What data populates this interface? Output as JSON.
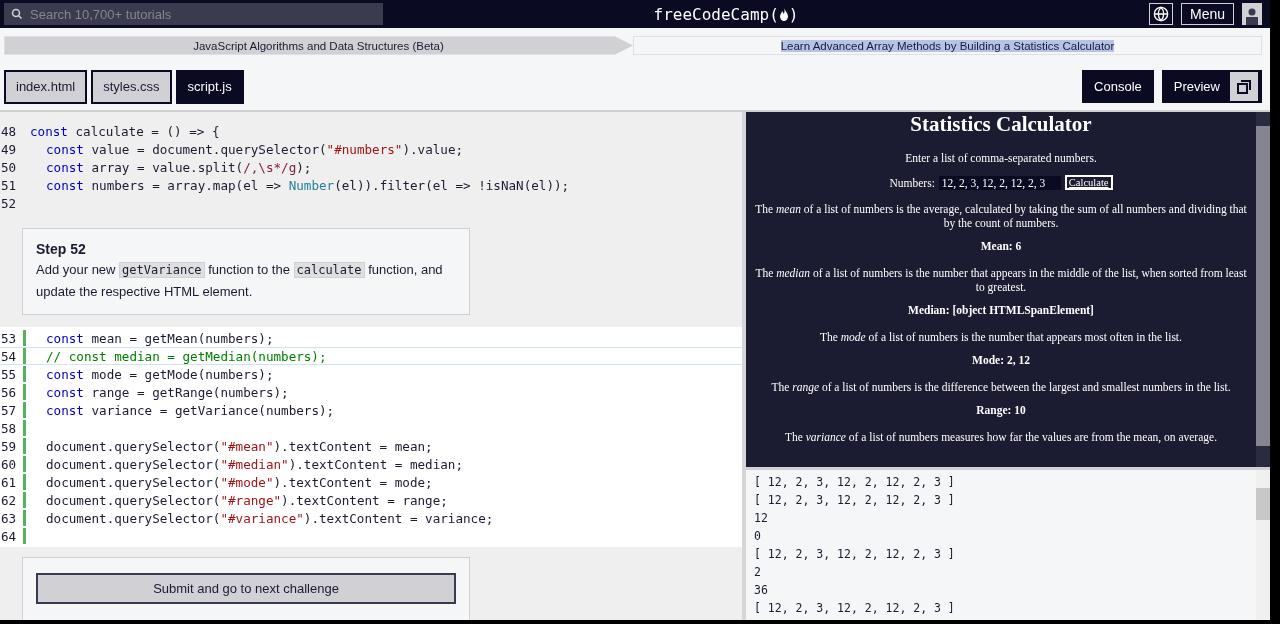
{
  "navbar": {
    "search": {
      "placeholder": "Search 10,700+ tutorials"
    },
    "logo": {
      "text": "freeCodeCamp",
      "open": "(",
      "close": ")"
    },
    "menu_button": "Menu"
  },
  "breadcrumb": [
    {
      "label": "JavaScript Algorithms and Data Structures (Beta)",
      "highlighted": false
    },
    {
      "label": "Learn Advanced Array Methods by Building a Statistics Calculator",
      "highlighted": true
    }
  ],
  "file_tabs": [
    {
      "label": "index.html",
      "selected": false
    },
    {
      "label": "styles.css",
      "selected": false
    },
    {
      "label": "script.js",
      "selected": true
    }
  ],
  "panel_buttons": [
    "Console",
    "Preview"
  ],
  "editor": {
    "code_top": [
      {
        "number": "48",
        "tokens": [
          {
            "kind": "keyword",
            "text": "const"
          },
          {
            "kind": "plain",
            "text": " calculate = () => {"
          }
        ]
      },
      {
        "number": "49",
        "indented": true,
        "tokens": [
          {
            "kind": "keyword",
            "text": "const"
          },
          {
            "kind": "plain",
            "text": " value = document.querySelector("
          },
          {
            "kind": "string",
            "text": "\"#numbers\""
          },
          {
            "kind": "plain",
            "text": ").value;"
          }
        ]
      },
      {
        "number": "50",
        "indented": true,
        "tokens": [
          {
            "kind": "keyword",
            "text": "const"
          },
          {
            "kind": "plain",
            "text": " array = value.split("
          },
          {
            "kind": "regex",
            "text": "/,\\s*/g"
          },
          {
            "kind": "plain",
            "text": ");"
          }
        ]
      },
      {
        "number": "51",
        "indented": true,
        "tokens": [
          {
            "kind": "keyword",
            "text": "const"
          },
          {
            "kind": "plain",
            "text": " numbers = array.map(el => "
          },
          {
            "kind": "builtin",
            "text": "Number"
          },
          {
            "kind": "plain",
            "text": "(el)).filter(el => !isNaN(el));"
          }
        ]
      },
      {
        "number": "52"
      }
    ],
    "step": {
      "title": "Step 52",
      "parts": [
        {
          "kind": "text",
          "text": "Add your new "
        },
        {
          "kind": "code",
          "text": "getVariance"
        },
        {
          "kind": "text",
          "text": " function to the "
        },
        {
          "kind": "code",
          "text": "calculate"
        },
        {
          "kind": "text",
          "text": " function, and update the respective HTML element."
        }
      ]
    },
    "code_bottom": [
      {
        "number": "53",
        "active": false,
        "indented": true,
        "tokens": [
          {
            "kind": "keyword",
            "text": "const"
          },
          {
            "kind": "plain",
            "text": " mean = getMean(numbers);"
          }
        ]
      },
      {
        "number": "54",
        "active": true,
        "indented": true,
        "tokens": [
          {
            "kind": "comment",
            "text": "// const median = getMedian(numbers);"
          }
        ]
      },
      {
        "number": "55",
        "active": false,
        "indented": true,
        "tokens": [
          {
            "kind": "keyword",
            "text": "const"
          },
          {
            "kind": "plain",
            "text": " mode = getMode(numbers);"
          }
        ]
      },
      {
        "number": "56",
        "active": false,
        "indented": true,
        "tokens": [
          {
            "kind": "keyword",
            "text": "const"
          },
          {
            "kind": "plain",
            "text": " range = getRange(numbers);"
          }
        ]
      },
      {
        "number": "57",
        "active": false,
        "indented": true,
        "tokens": [
          {
            "kind": "keyword",
            "text": "const"
          },
          {
            "kind": "plain",
            "text": " variance = getVariance(numbers);"
          }
        ]
      },
      {
        "number": "58",
        "active": false
      },
      {
        "number": "59",
        "active": false,
        "indented": true,
        "tokens": [
          {
            "kind": "plain",
            "text": "document.querySelector("
          },
          {
            "kind": "string",
            "text": "\"#mean\""
          },
          {
            "kind": "plain",
            "text": ").textContent = mean;"
          }
        ]
      },
      {
        "number": "60",
        "active": false,
        "indented": true,
        "tokens": [
          {
            "kind": "plain",
            "text": "document.querySelector("
          },
          {
            "kind": "string",
            "text": "\"#median\""
          },
          {
            "kind": "plain",
            "text": ").textContent = median;"
          }
        ]
      },
      {
        "number": "61",
        "active": false,
        "indented": true,
        "tokens": [
          {
            "kind": "plain",
            "text": "document.querySelector("
          },
          {
            "kind": "string",
            "text": "\"#mode\""
          },
          {
            "kind": "plain",
            "text": ").textContent = mode;"
          }
        ]
      },
      {
        "number": "62",
        "active": false,
        "indented": true,
        "tokens": [
          {
            "kind": "plain",
            "text": "document.querySelector("
          },
          {
            "kind": "string",
            "text": "\"#range\""
          },
          {
            "kind": "plain",
            "text": ").textContent = range;"
          }
        ]
      },
      {
        "number": "63",
        "active": false,
        "indented": true,
        "tokens": [
          {
            "kind": "plain",
            "text": "document.querySelector("
          },
          {
            "kind": "string",
            "text": "\"#variance\""
          },
          {
            "kind": "plain",
            "text": ").textContent = variance;"
          }
        ]
      },
      {
        "number": "64",
        "active": false
      }
    ],
    "submit_button": "Submit and go to next challenge"
  },
  "preview": {
    "title": "Statistics Calculator",
    "intro": "Enter a list of comma-separated numbers.",
    "input_label": "Numbers:",
    "input_value": "12, 2, 3, 12, 2, 12, 2, 3",
    "calculate_button": "Calculate",
    "blocks": [
      {
        "kind": "paragraph",
        "text": "The *mean* of a list of numbers is the average, calculated by taking the sum of all numbers and dividing that by the count of numbers."
      },
      {
        "kind": "result",
        "text": "Mean: 6"
      },
      {
        "kind": "paragraph",
        "text": "The *median* of a list of numbers is the number that appears in the middle of the list, when sorted from least to greatest."
      },
      {
        "kind": "result",
        "text": "Median: [object HTMLSpanElement]"
      },
      {
        "kind": "paragraph",
        "text": "The *mode* of a list of numbers is the number that appears most often in the list."
      },
      {
        "kind": "result",
        "text": "Mode: 2, 12"
      },
      {
        "kind": "paragraph",
        "text": "The *range* of a list of numbers is the difference between the largest and smallest numbers in the list."
      },
      {
        "kind": "result",
        "text": "Range: 10"
      },
      {
        "kind": "paragraph",
        "text": "The *variance* of a list of numbers measures how far the values are from the mean, on average."
      }
    ]
  },
  "console": [
    "[ 12, 2, 3, 12, 2, 12, 2, 3 ]",
    "[ 12, 2, 3, 12, 2, 12, 2, 3 ]",
    "12",
    "0",
    "[ 12, 2, 3, 12, 2, 12, 2, 3 ]",
    "2",
    "36",
    "[ 12, 2, 3, 12, 2, 12, 2, 3 ]"
  ]
}
